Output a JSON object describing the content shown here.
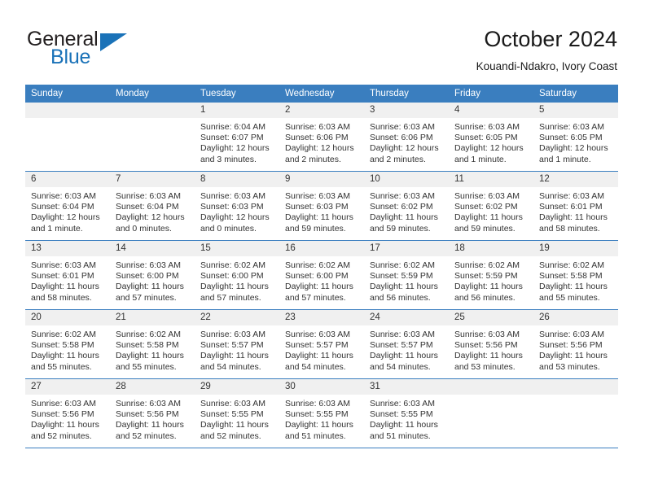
{
  "brand": {
    "name_top": "General",
    "name_bottom": "Blue",
    "flag_icon": "triangle-flag-icon",
    "color_dark": "#231f20",
    "color_blue": "#1a72b8"
  },
  "header": {
    "month_title": "October 2024",
    "location": "Kouandi-Ndakro, Ivory Coast"
  },
  "theme": {
    "header_blue": "#3a7ebf",
    "daynum_band": "#f0f0f0",
    "text": "#333333"
  },
  "calendar": {
    "weekday_headers": [
      "Sunday",
      "Monday",
      "Tuesday",
      "Wednesday",
      "Thursday",
      "Friday",
      "Saturday"
    ],
    "weeks": [
      [
        {
          "day": "",
          "sunrise": "",
          "sunset": "",
          "daylight": "",
          "empty": true
        },
        {
          "day": "",
          "sunrise": "",
          "sunset": "",
          "daylight": "",
          "empty": true
        },
        {
          "day": "1",
          "sunrise": "Sunrise: 6:04 AM",
          "sunset": "Sunset: 6:07 PM",
          "daylight": "Daylight: 12 hours and 3 minutes."
        },
        {
          "day": "2",
          "sunrise": "Sunrise: 6:03 AM",
          "sunset": "Sunset: 6:06 PM",
          "daylight": "Daylight: 12 hours and 2 minutes."
        },
        {
          "day": "3",
          "sunrise": "Sunrise: 6:03 AM",
          "sunset": "Sunset: 6:06 PM",
          "daylight": "Daylight: 12 hours and 2 minutes."
        },
        {
          "day": "4",
          "sunrise": "Sunrise: 6:03 AM",
          "sunset": "Sunset: 6:05 PM",
          "daylight": "Daylight: 12 hours and 1 minute."
        },
        {
          "day": "5",
          "sunrise": "Sunrise: 6:03 AM",
          "sunset": "Sunset: 6:05 PM",
          "daylight": "Daylight: 12 hours and 1 minute."
        }
      ],
      [
        {
          "day": "6",
          "sunrise": "Sunrise: 6:03 AM",
          "sunset": "Sunset: 6:04 PM",
          "daylight": "Daylight: 12 hours and 1 minute."
        },
        {
          "day": "7",
          "sunrise": "Sunrise: 6:03 AM",
          "sunset": "Sunset: 6:04 PM",
          "daylight": "Daylight: 12 hours and 0 minutes."
        },
        {
          "day": "8",
          "sunrise": "Sunrise: 6:03 AM",
          "sunset": "Sunset: 6:03 PM",
          "daylight": "Daylight: 12 hours and 0 minutes."
        },
        {
          "day": "9",
          "sunrise": "Sunrise: 6:03 AM",
          "sunset": "Sunset: 6:03 PM",
          "daylight": "Daylight: 11 hours and 59 minutes."
        },
        {
          "day": "10",
          "sunrise": "Sunrise: 6:03 AM",
          "sunset": "Sunset: 6:02 PM",
          "daylight": "Daylight: 11 hours and 59 minutes."
        },
        {
          "day": "11",
          "sunrise": "Sunrise: 6:03 AM",
          "sunset": "Sunset: 6:02 PM",
          "daylight": "Daylight: 11 hours and 59 minutes."
        },
        {
          "day": "12",
          "sunrise": "Sunrise: 6:03 AM",
          "sunset": "Sunset: 6:01 PM",
          "daylight": "Daylight: 11 hours and 58 minutes."
        }
      ],
      [
        {
          "day": "13",
          "sunrise": "Sunrise: 6:03 AM",
          "sunset": "Sunset: 6:01 PM",
          "daylight": "Daylight: 11 hours and 58 minutes."
        },
        {
          "day": "14",
          "sunrise": "Sunrise: 6:03 AM",
          "sunset": "Sunset: 6:00 PM",
          "daylight": "Daylight: 11 hours and 57 minutes."
        },
        {
          "day": "15",
          "sunrise": "Sunrise: 6:02 AM",
          "sunset": "Sunset: 6:00 PM",
          "daylight": "Daylight: 11 hours and 57 minutes."
        },
        {
          "day": "16",
          "sunrise": "Sunrise: 6:02 AM",
          "sunset": "Sunset: 6:00 PM",
          "daylight": "Daylight: 11 hours and 57 minutes."
        },
        {
          "day": "17",
          "sunrise": "Sunrise: 6:02 AM",
          "sunset": "Sunset: 5:59 PM",
          "daylight": "Daylight: 11 hours and 56 minutes."
        },
        {
          "day": "18",
          "sunrise": "Sunrise: 6:02 AM",
          "sunset": "Sunset: 5:59 PM",
          "daylight": "Daylight: 11 hours and 56 minutes."
        },
        {
          "day": "19",
          "sunrise": "Sunrise: 6:02 AM",
          "sunset": "Sunset: 5:58 PM",
          "daylight": "Daylight: 11 hours and 55 minutes."
        }
      ],
      [
        {
          "day": "20",
          "sunrise": "Sunrise: 6:02 AM",
          "sunset": "Sunset: 5:58 PM",
          "daylight": "Daylight: 11 hours and 55 minutes."
        },
        {
          "day": "21",
          "sunrise": "Sunrise: 6:02 AM",
          "sunset": "Sunset: 5:58 PM",
          "daylight": "Daylight: 11 hours and 55 minutes."
        },
        {
          "day": "22",
          "sunrise": "Sunrise: 6:03 AM",
          "sunset": "Sunset: 5:57 PM",
          "daylight": "Daylight: 11 hours and 54 minutes."
        },
        {
          "day": "23",
          "sunrise": "Sunrise: 6:03 AM",
          "sunset": "Sunset: 5:57 PM",
          "daylight": "Daylight: 11 hours and 54 minutes."
        },
        {
          "day": "24",
          "sunrise": "Sunrise: 6:03 AM",
          "sunset": "Sunset: 5:57 PM",
          "daylight": "Daylight: 11 hours and 54 minutes."
        },
        {
          "day": "25",
          "sunrise": "Sunrise: 6:03 AM",
          "sunset": "Sunset: 5:56 PM",
          "daylight": "Daylight: 11 hours and 53 minutes."
        },
        {
          "day": "26",
          "sunrise": "Sunrise: 6:03 AM",
          "sunset": "Sunset: 5:56 PM",
          "daylight": "Daylight: 11 hours and 53 minutes."
        }
      ],
      [
        {
          "day": "27",
          "sunrise": "Sunrise: 6:03 AM",
          "sunset": "Sunset: 5:56 PM",
          "daylight": "Daylight: 11 hours and 52 minutes."
        },
        {
          "day": "28",
          "sunrise": "Sunrise: 6:03 AM",
          "sunset": "Sunset: 5:56 PM",
          "daylight": "Daylight: 11 hours and 52 minutes."
        },
        {
          "day": "29",
          "sunrise": "Sunrise: 6:03 AM",
          "sunset": "Sunset: 5:55 PM",
          "daylight": "Daylight: 11 hours and 52 minutes."
        },
        {
          "day": "30",
          "sunrise": "Sunrise: 6:03 AM",
          "sunset": "Sunset: 5:55 PM",
          "daylight": "Daylight: 11 hours and 51 minutes."
        },
        {
          "day": "31",
          "sunrise": "Sunrise: 6:03 AM",
          "sunset": "Sunset: 5:55 PM",
          "daylight": "Daylight: 11 hours and 51 minutes."
        },
        {
          "day": "",
          "sunrise": "",
          "sunset": "",
          "daylight": "",
          "empty": true
        },
        {
          "day": "",
          "sunrise": "",
          "sunset": "",
          "daylight": "",
          "empty": true
        }
      ]
    ]
  }
}
